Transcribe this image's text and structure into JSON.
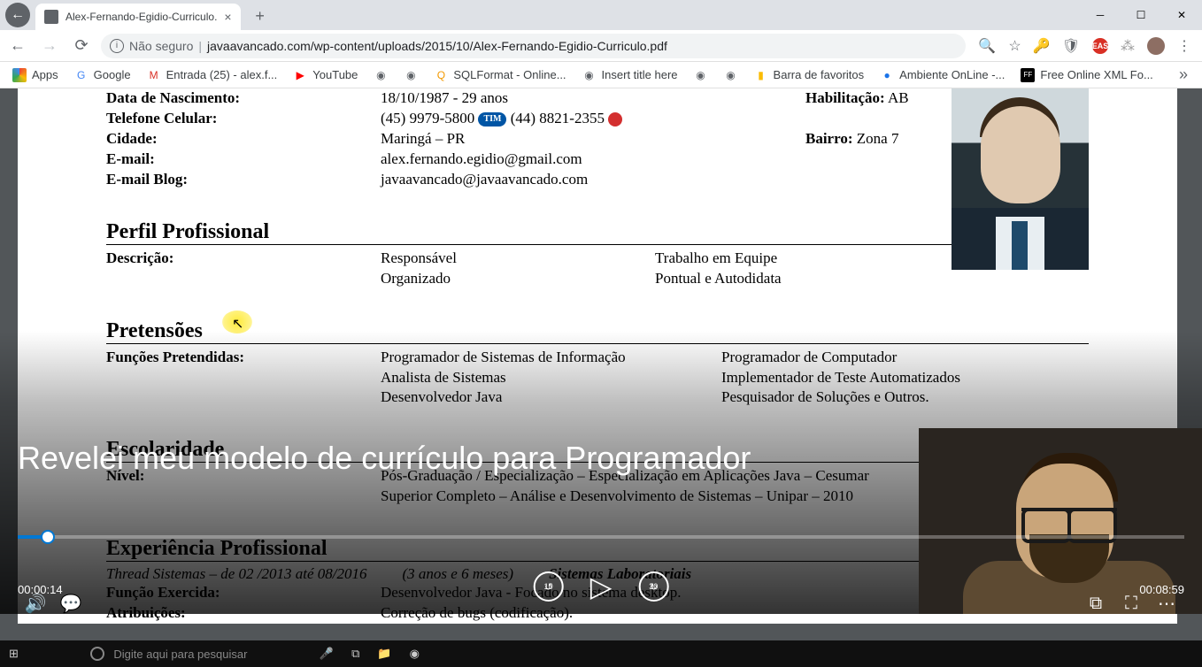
{
  "chrome": {
    "tab_title": "Alex-Fernando-Egidio-Curriculo.",
    "security_label": "Não seguro",
    "url": "javaavancado.com/wp-content/uploads/2015/10/Alex-Fernando-Egidio-Curriculo.pdf"
  },
  "bookmarks": {
    "apps": "Apps",
    "items": [
      {
        "label": "Google",
        "icon": "G",
        "color": "#4285f4"
      },
      {
        "label": "Entrada (25) - alex.f...",
        "icon": "M",
        "color": "#d93025"
      },
      {
        "label": "YouTube",
        "icon": "▶",
        "color": "#ff0000"
      },
      {
        "label": "",
        "icon": "◉",
        "color": "#5f6368"
      },
      {
        "label": "",
        "icon": "◉",
        "color": "#5f6368"
      },
      {
        "label": "SQLFormat - Online...",
        "icon": "Q",
        "color": "#f29900"
      },
      {
        "label": "Insert title here",
        "icon": "◉",
        "color": "#5f6368"
      },
      {
        "label": "",
        "icon": "◉",
        "color": "#5f6368"
      },
      {
        "label": "",
        "icon": "◉",
        "color": "#5f6368"
      },
      {
        "label": "Barra de favoritos",
        "icon": "▮",
        "color": "#fbbc04"
      },
      {
        "label": "Ambiente OnLine -...",
        "icon": "●",
        "color": "#1a73e8"
      },
      {
        "label": "Free Online XML Fo...",
        "icon": "FF",
        "color": "#000"
      }
    ]
  },
  "cv": {
    "labels": {
      "dob": "Data de Nascimento:",
      "phone": "Telefone Celular:",
      "city": "Cidade:",
      "email": "E-mail:",
      "email_blog": "E-mail Blog:",
      "habilitacao": "Habilitação:",
      "bairro": "Bairro:",
      "descricao": "Descrição:",
      "funcoes": "Funções Pretendidas:",
      "nivel": "Nível:",
      "funcao_exercida": "Função Exercida:",
      "atribuicoes": "Atribuições:"
    },
    "values": {
      "dob": "18/10/1987 - 29 anos",
      "phone1": "(45) 9979-5800",
      "phone2": "(44) 8821-2355",
      "city": "Maringá – PR",
      "email": "alex.fernando.egidio@gmail.com",
      "email_blog": "javaavancado@javaavancado.com",
      "habilitacao": "AB",
      "bairro": "Zona 7"
    },
    "sections": {
      "perfil": "Perfil Profissional",
      "pretensoes": "Pretensões",
      "escolaridade": "Escolaridade",
      "experiencia": "Experiência Profissional"
    },
    "perfil": {
      "c1a": "Responsável",
      "c1b": "Organizado",
      "c2a": "Trabalho em Equipe",
      "c2b": "Pontual e Autodidata"
    },
    "pretensoes_cols": {
      "c1": [
        "Programador de Sistemas de Informação",
        "Analista de Sistemas",
        "Desenvolvedor Java"
      ],
      "c2": [
        "Programador de Computador",
        "Implementador de Teste Automatizados",
        "Pesquisador de Soluções e Outros."
      ]
    },
    "escolaridade": {
      "l1": "Pós-Graduação / Especialização – Especialização em Aplicações Java – Cesumar",
      "l2": "Superior Completo – Análise e Desenvolvimento de Sistemas – Unipar – 2010"
    },
    "experiencia": {
      "empresa": "Thread Sistemas – de 02 /2013 até 08/2016",
      "duracao": "(3 anos e 6 meses)",
      "area": "Sistemas Laboratoriais",
      "funcao": "Desenvolvedor Java  - Focado no sistema desktop.",
      "atrib": "Correção de bugs (codificação)."
    }
  },
  "video": {
    "title": "Revelei meu modelo de currículo para Programador",
    "time_current": "00:00:14",
    "time_total": "00:08:59",
    "skip_back": "10",
    "skip_fwd": "30"
  },
  "taskbar": {
    "search_placeholder": "Digite aqui para pesquisar"
  }
}
